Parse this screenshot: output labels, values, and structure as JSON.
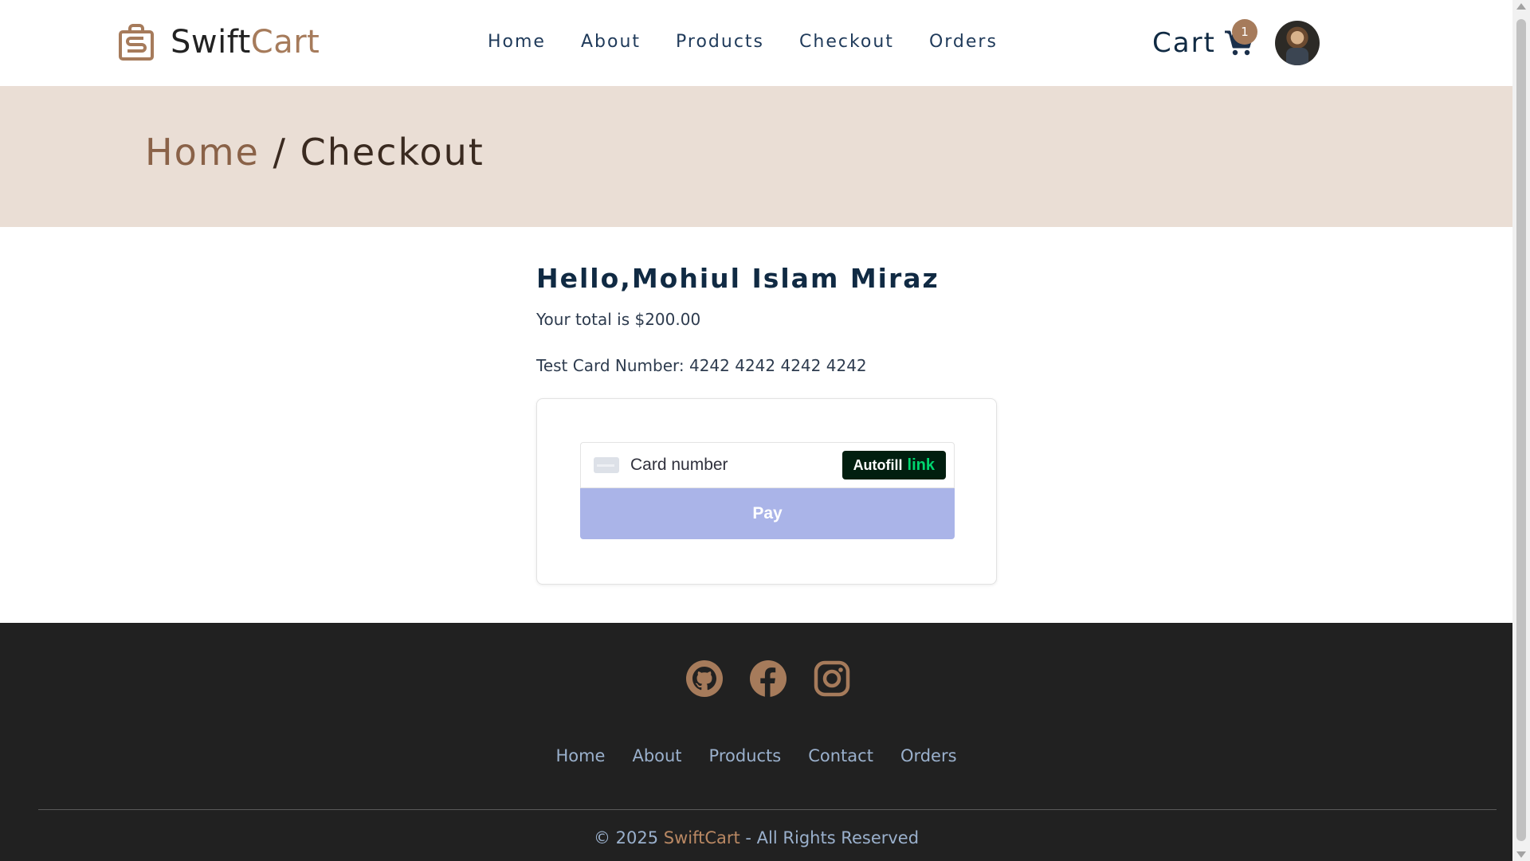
{
  "brand": {
    "name_part1": "Swift",
    "name_part2": "Cart",
    "accent_color": "#a67b5b"
  },
  "nav": {
    "items": [
      {
        "label": "Home"
      },
      {
        "label": "About"
      },
      {
        "label": "Products"
      },
      {
        "label": "Checkout"
      },
      {
        "label": "Orders"
      }
    ]
  },
  "cart": {
    "label": "Cart",
    "count": "1"
  },
  "breadcrumb": {
    "home": "Home",
    "separator": " / ",
    "current": "Checkout"
  },
  "checkout": {
    "greeting": "Hello,Mohiul Islam Miraz",
    "total": "Your total is $200.00",
    "test_card": "Test Card Number: 4242 4242 4242 4242",
    "card_placeholder": "Card number",
    "autofill_text": "Autofill",
    "autofill_link": "link",
    "pay_label": "Pay"
  },
  "footer": {
    "socials": [
      {
        "icon": "github-icon"
      },
      {
        "icon": "facebook-icon"
      },
      {
        "icon": "instagram-icon"
      }
    ],
    "links": [
      {
        "label": "Home"
      },
      {
        "label": "About"
      },
      {
        "label": "Products"
      },
      {
        "label": "Contact"
      },
      {
        "label": "Orders"
      }
    ],
    "copyright_prefix": "© 2025 ",
    "copyright_brand": "SwiftCart",
    "copyright_suffix": " - All Rights Reserved"
  },
  "colors": {
    "banner": "#eaded5",
    "footer": "#212121",
    "pay_button": "#aab4e8",
    "link_green": "#00d66f"
  }
}
